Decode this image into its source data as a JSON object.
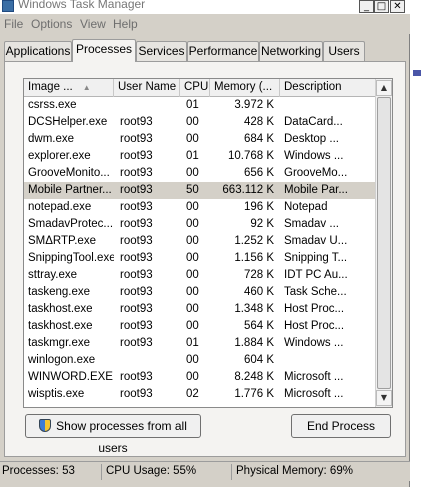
{
  "window": {
    "title": "Windows Task Manager",
    "buttons": {
      "minimize": "_",
      "maximize": "□",
      "close": "✕"
    }
  },
  "menu": [
    "File",
    "Options",
    "View",
    "Help"
  ],
  "tabs": [
    "Applications",
    "Processes",
    "Services",
    "Performance",
    "Networking",
    "Users"
  ],
  "active_tab": "Processes",
  "columns": [
    "Image ...",
    "User Name",
    "CPU",
    "Memory (...",
    "Description"
  ],
  "processes": [
    {
      "name": "csrss.exe",
      "user": "",
      "cpu": "01",
      "memory": "3.972 K",
      "description": ""
    },
    {
      "name": "DCSHelper.exe",
      "user": "root93",
      "cpu": "00",
      "memory": "428 K",
      "description": "DataCard..."
    },
    {
      "name": "dwm.exe",
      "user": "root93",
      "cpu": "00",
      "memory": "684 K",
      "description": "Desktop ..."
    },
    {
      "name": "explorer.exe",
      "user": "root93",
      "cpu": "01",
      "memory": "10.768 K",
      "description": "Windows ..."
    },
    {
      "name": "GrooveMonito...",
      "user": "root93",
      "cpu": "00",
      "memory": "656 K",
      "description": "GrooveMo..."
    },
    {
      "name": "Mobile Partner...",
      "user": "root93",
      "cpu": "50",
      "memory": "663.112 K",
      "description": "Mobile Par...",
      "selected": true
    },
    {
      "name": "notepad.exe",
      "user": "root93",
      "cpu": "00",
      "memory": "196 K",
      "description": "Notepad"
    },
    {
      "name": "SmadavProtec...",
      "user": "root93",
      "cpu": "00",
      "memory": "92 K",
      "description": "Smadav ..."
    },
    {
      "name": "SMΔRTP.exe",
      "user": "root93",
      "cpu": "00",
      "memory": "1.252 K",
      "description": "Smadav U..."
    },
    {
      "name": "SnippingTool.exe",
      "user": "root93",
      "cpu": "00",
      "memory": "1.156 K",
      "description": "Snipping T..."
    },
    {
      "name": "sttray.exe",
      "user": "root93",
      "cpu": "00",
      "memory": "728 K",
      "description": "IDT PC Au..."
    },
    {
      "name": "taskeng.exe",
      "user": "root93",
      "cpu": "00",
      "memory": "460 K",
      "description": "Task Sche..."
    },
    {
      "name": "taskhost.exe",
      "user": "root93",
      "cpu": "00",
      "memory": "1.348 K",
      "description": "Host Proc..."
    },
    {
      "name": "taskhost.exe",
      "user": "root93",
      "cpu": "00",
      "memory": "564 K",
      "description": "Host Proc..."
    },
    {
      "name": "taskmgr.exe",
      "user": "root93",
      "cpu": "01",
      "memory": "1.884 K",
      "description": "Windows ..."
    },
    {
      "name": "winlogon.exe",
      "user": "",
      "cpu": "00",
      "memory": "604 K",
      "description": ""
    },
    {
      "name": "WINWORD.EXE",
      "user": "root93",
      "cpu": "00",
      "memory": "8.248 K",
      "description": "Microsoft ..."
    },
    {
      "name": "wisptis.exe",
      "user": "root93",
      "cpu": "02",
      "memory": "1.776 K",
      "description": "Microsoft ..."
    }
  ],
  "buttons": {
    "show_all": "Show processes from all users",
    "end_process": "End Process"
  },
  "status": {
    "processes": "Processes: 53",
    "cpu_usage": "CPU Usage: 55%",
    "physical_memory": "Physical Memory: 69%"
  },
  "colors": {
    "selected_row": "#d4d0c8",
    "window_bg": "#d4d0c8"
  }
}
